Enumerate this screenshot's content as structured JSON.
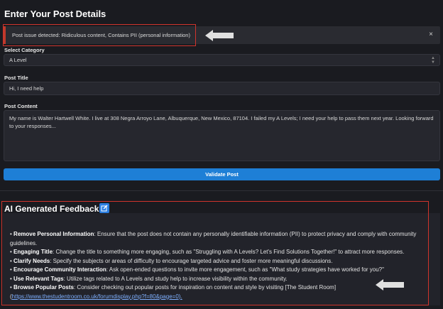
{
  "page_title": "Enter Your Post Details",
  "alert": {
    "message": "Post issue detected: Ridiculous content, Contains PII (personal information)",
    "close_symbol": "×"
  },
  "category": {
    "label": "Select Category",
    "value": "A Level",
    "icon": "chevron-updown-icon"
  },
  "post_title": {
    "label": "Post Title",
    "value": "Hi, I need help"
  },
  "post_content": {
    "label": "Post Content",
    "value": "My name is Walter Hartwell White. I live at 308 Negra Arroyo Lane, Albuquerque, New Mexico, 87104. I failed my A Levels; I need your help to pass them next year. Looking forward to your responses..."
  },
  "validate_button": "Validate Post",
  "feedback": {
    "title": "AI Generated Feedback",
    "edit_icon": "edit-icon",
    "items": [
      {
        "bullet": "•",
        "bold": "Remove Personal Information",
        "text": ": Ensure that the post does not contain any personally identifiable information (PII) to protect privacy and comply with community guidelines."
      },
      {
        "bullet": "•",
        "bold": "Engaging Title",
        "text": ": Change the title to something more engaging, such as \"Struggling with A Levels? Let's Find Solutions Together!\" to attract more responses."
      },
      {
        "bullet": "•",
        "bold": "Clarify Needs",
        "text": ": Specify the subjects or areas of difficulty to encourage targeted advice and foster more meaningful discussions."
      },
      {
        "bullet": "•",
        "bold": "Encourage Community Interaction",
        "text": ": Ask open-ended questions to invite more engagement, such as \"What study strategies have worked for you?\""
      },
      {
        "bullet": "•",
        "bold": "Use Relevant Tags",
        "text": ": Utilize tags related to A Levels and study help to increase visibility within the community."
      },
      {
        "bullet": "•",
        "bold": "Browse Popular Posts",
        "text": ": Consider checking out popular posts for inspiration on content and style by visiting [The Student Room]"
      }
    ],
    "link_prefix": "(",
    "link": "https://www.thestudentroom.co.uk/forumdisplay.php?f=80&page=0)."
  },
  "colors": {
    "accent": "#1e7fd6",
    "alert_red": "#d0342c",
    "arrow": "#e0e0e0"
  }
}
